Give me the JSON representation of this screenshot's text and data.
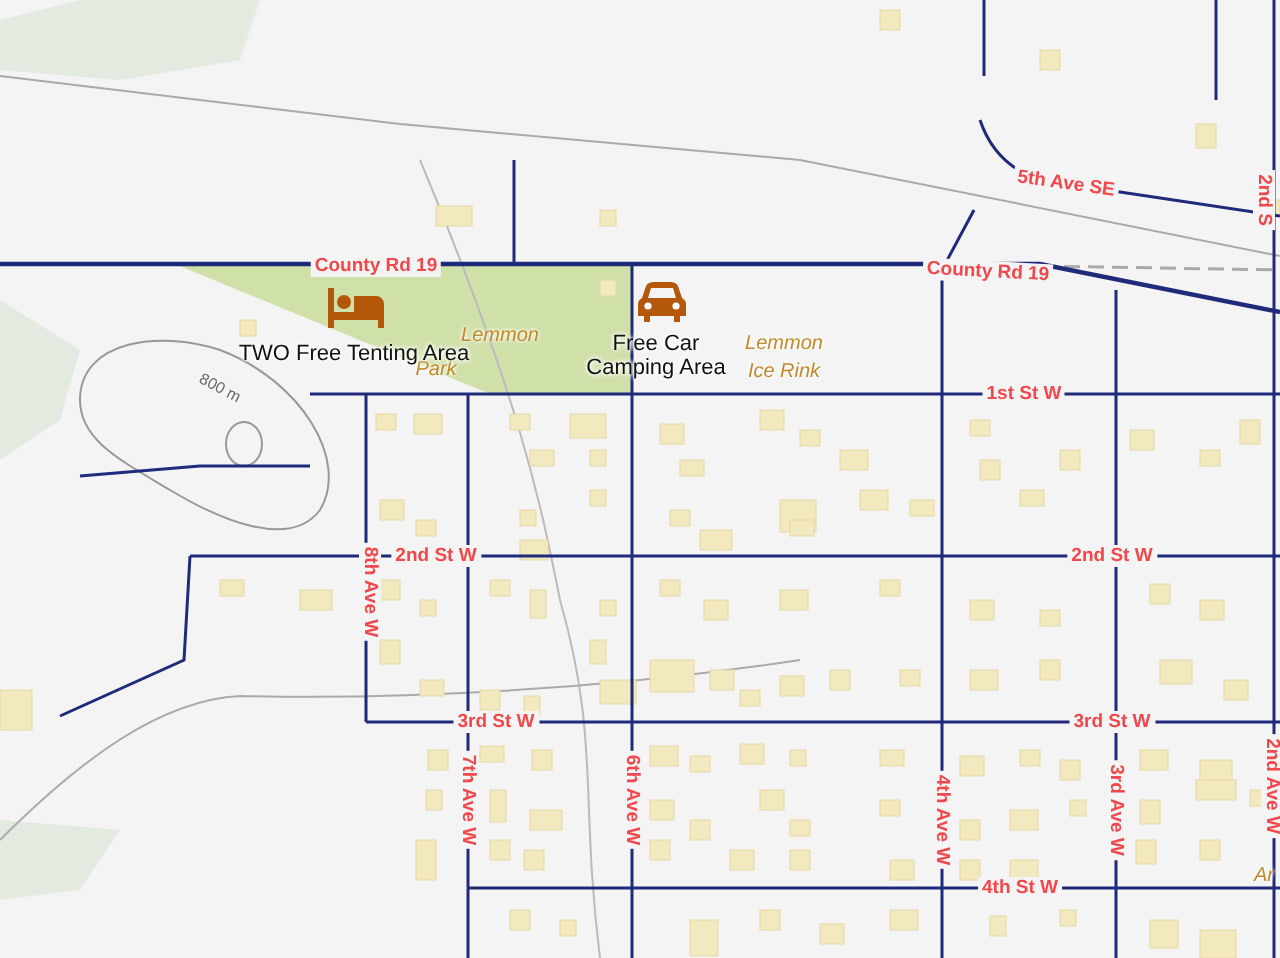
{
  "map": {
    "street_labels": [
      {
        "text": "County Rd 19"
      },
      {
        "text": "County Rd 19"
      },
      {
        "text": "5th Ave SE"
      },
      {
        "text": "2nd S"
      },
      {
        "text": "1st St W"
      },
      {
        "text": "2nd St W"
      },
      {
        "text": "2nd St W"
      },
      {
        "text": "3rd St W"
      },
      {
        "text": "3rd St W"
      },
      {
        "text": "4th St W"
      },
      {
        "text": "8th Ave W"
      },
      {
        "text": "7th Ave W"
      },
      {
        "text": "6th Ave W"
      },
      {
        "text": "4th Ave W"
      },
      {
        "text": "3rd Ave W"
      },
      {
        "text": "2nd Ave W"
      }
    ],
    "places": [
      {
        "kind": "tent",
        "label": "TWO Free Tenting Area"
      },
      {
        "kind": "car",
        "label": "Free Car Camping Area"
      }
    ],
    "area_labels": [
      {
        "text": "Lemmon"
      },
      {
        "text": "Park"
      },
      {
        "text": "Lemmon"
      },
      {
        "text": "Ice Rink"
      },
      {
        "text": "Ar"
      }
    ],
    "contour_label": "800 m"
  }
}
